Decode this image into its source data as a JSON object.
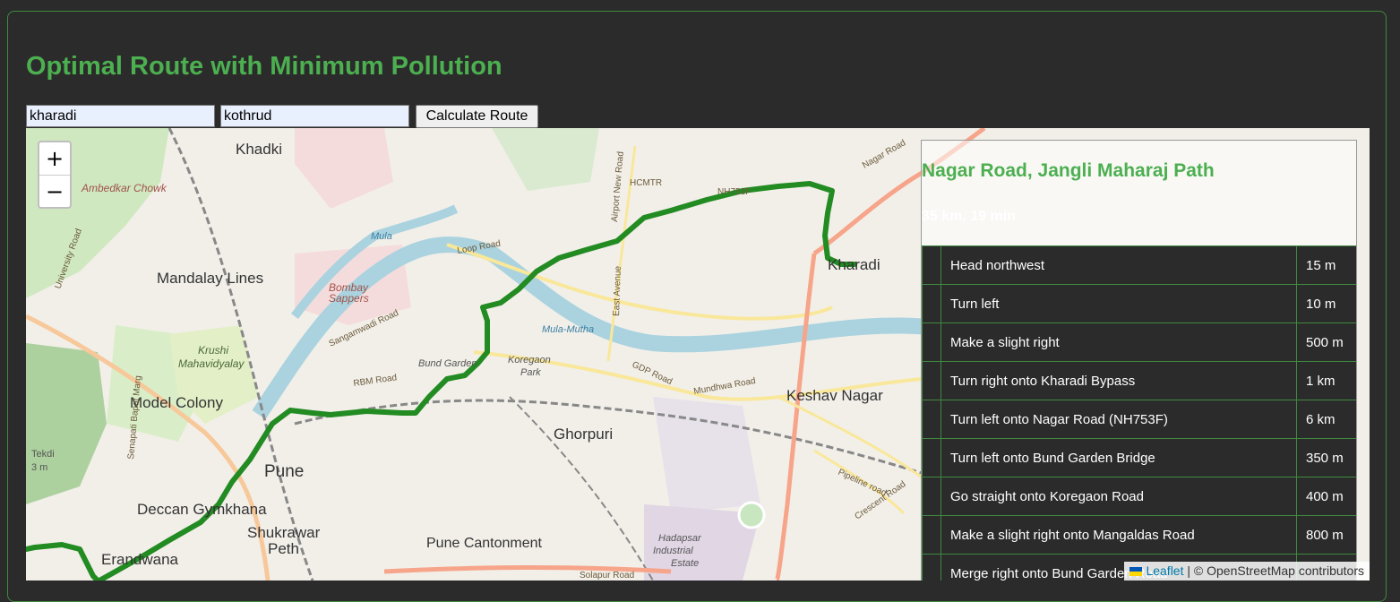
{
  "page": {
    "title": "Optimal Route with Minimum Pollution"
  },
  "form": {
    "from_value": "kharadi",
    "to_value": "kothrud",
    "calculate_label": "Calculate Route"
  },
  "map": {
    "zoom_in": "+",
    "zoom_out": "−",
    "labels": {
      "khadki": "Khadki",
      "ambedkar_chowk": "Ambedkar Chowk",
      "mandalay_lines": "Mandalay Lines",
      "bombay_sappers_1": "Bombay",
      "bombay_sappers_2": "Sappers",
      "krushi_1": "Krushi",
      "krushi_2": "Mahavidyalay",
      "model_colony": "Model Colony",
      "pune": "Pune",
      "deccan_gymkhana": "Deccan Gymkhana",
      "shukrawar_1": "Shukrawar",
      "shukrawar_2": "Peth",
      "erandwane": "Erandwana",
      "pune_cantonment": "Pune Cantonment",
      "ghorpuri": "Ghorpuri",
      "keshav_nagar": "Keshav Nagar",
      "kharadi": "Kharadi",
      "koregaon_park_1": "Koregaon",
      "koregaon_park_2": "Park",
      "bund_garden": "Bund Garden",
      "hadapsar_1": "Hadapsar",
      "hadapsar_2": "Industrial",
      "hadapsar_3": "Estate",
      "tekdi": "Tekdi",
      "mula": "Mula",
      "mula_mutha": "Mula-Mutha",
      "loop_road": "Loop Road",
      "rbm_road": "RBM Road",
      "gdp_road": "GDP Road",
      "mundhwa_road": "Mundhwa Road",
      "pipeline_road": "Pipeline road",
      "crescent_road": "Crescent Road",
      "sangamwadi_road": "Sangamwadi Road",
      "airport_new_road": "Airport New Road",
      "hcmtr": "HCMTR",
      "nagar_road": "Nagar Road",
      "nh753f": "NH753F",
      "university_road": "University Road",
      "east_avenue": "East Avenue",
      "senapati_bapat_marg": "Senapati Bapat Marg",
      "solapur_road": "Solapur Road",
      "tekdi_elev": "3 m"
    },
    "attribution": {
      "leaflet": "Leaflet",
      "separator": " | © OpenStreetMap contributors"
    }
  },
  "route": {
    "name": "Nagar Road, Jangli Maharaj Path",
    "summary": "35 km, 19 min",
    "steps": [
      {
        "instruction": "Head northwest",
        "distance": "15 m"
      },
      {
        "instruction": "Turn left",
        "distance": "10 m"
      },
      {
        "instruction": "Make a slight right",
        "distance": "500 m"
      },
      {
        "instruction": "Turn right onto Kharadi Bypass",
        "distance": "1 km"
      },
      {
        "instruction": "Turn left onto Nagar Road (NH753F)",
        "distance": "6 km"
      },
      {
        "instruction": "Turn left onto Bund Garden Bridge",
        "distance": "350 m"
      },
      {
        "instruction": "Go straight onto Koregaon Road",
        "distance": "400 m"
      },
      {
        "instruction": "Make a slight right onto Mangaldas Road",
        "distance": "800 m"
      },
      {
        "instruction": "Merge right onto Bund Garden Road",
        "distance": ""
      }
    ]
  },
  "colors": {
    "accent": "#4caf50",
    "route_line": "#228b22",
    "background": "#2b2b2b"
  }
}
